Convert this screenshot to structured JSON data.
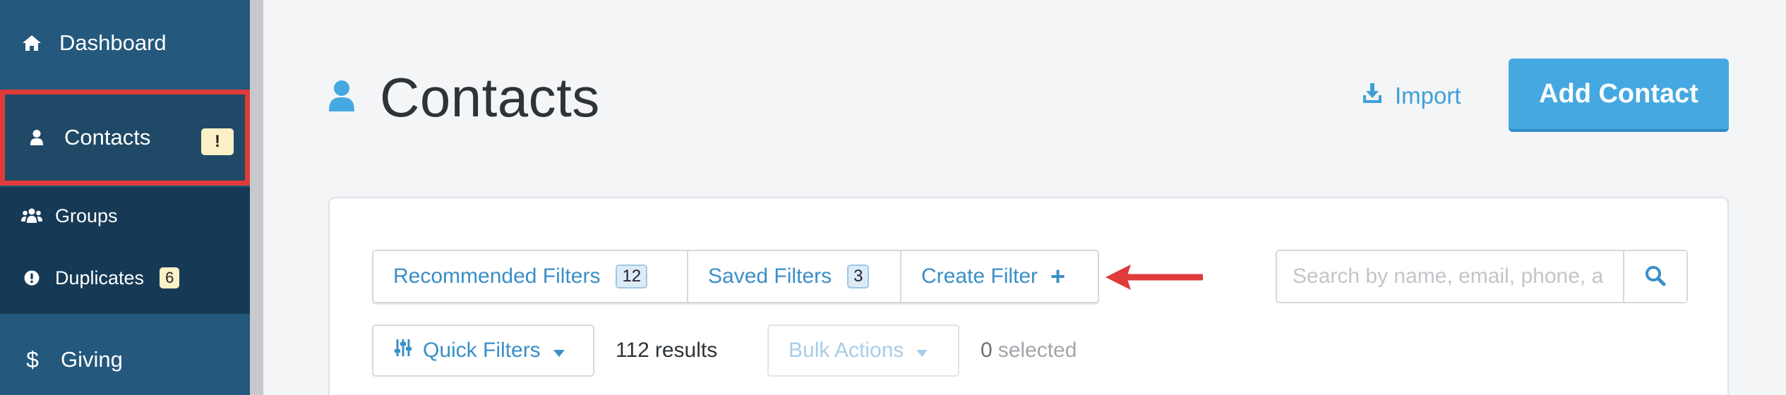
{
  "sidebar": {
    "dashboard": {
      "label": "Dashboard",
      "icon": "home-icon"
    },
    "contacts": {
      "label": "Contacts",
      "icon": "person-icon",
      "badge": "!"
    },
    "groups": {
      "label": "Groups",
      "icon": "users-icon"
    },
    "duplicates": {
      "label": "Duplicates",
      "icon": "exclamation-circle-icon",
      "badge": "6"
    },
    "giving": {
      "label": "Giving",
      "icon": "dollar-icon",
      "glyph": "$"
    }
  },
  "header": {
    "title": "Contacts",
    "import_label": "Import",
    "add_contact_label": "Add Contact"
  },
  "filters": {
    "recommended": {
      "label": "Recommended Filters",
      "count": "12"
    },
    "saved": {
      "label": "Saved Filters",
      "count": "3"
    },
    "create": {
      "label": "Create Filter",
      "icon": "plus-icon",
      "glyph": "+"
    }
  },
  "search": {
    "placeholder": "Search by name, email, phone, a",
    "value": ""
  },
  "toolbar": {
    "quick_filters_label": "Quick Filters",
    "results_count": "112",
    "results_label": "results",
    "bulk_actions_label": "Bulk Actions",
    "selected_count": "0",
    "selected_label": "selected"
  },
  "colors": {
    "sidebar_bg": "#24587d",
    "subnav_bg": "#163a55",
    "accent_blue": "#45a8e1",
    "link_blue": "#3a8fc7",
    "highlight_red": "#e03a3a",
    "badge_yellow": "#fbf0c6"
  }
}
